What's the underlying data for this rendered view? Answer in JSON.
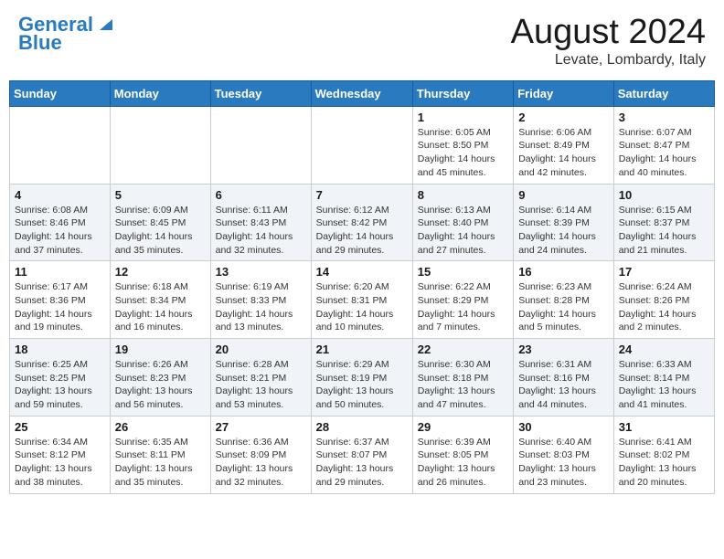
{
  "header": {
    "logo_line1": "General",
    "logo_line2": "Blue",
    "month": "August 2024",
    "location": "Levate, Lombardy, Italy"
  },
  "weekdays": [
    "Sunday",
    "Monday",
    "Tuesday",
    "Wednesday",
    "Thursday",
    "Friday",
    "Saturday"
  ],
  "weeks": [
    [
      {
        "day": "",
        "info": ""
      },
      {
        "day": "",
        "info": ""
      },
      {
        "day": "",
        "info": ""
      },
      {
        "day": "",
        "info": ""
      },
      {
        "day": "1",
        "info": "Sunrise: 6:05 AM\nSunset: 8:50 PM\nDaylight: 14 hours and 45 minutes."
      },
      {
        "day": "2",
        "info": "Sunrise: 6:06 AM\nSunset: 8:49 PM\nDaylight: 14 hours and 42 minutes."
      },
      {
        "day": "3",
        "info": "Sunrise: 6:07 AM\nSunset: 8:47 PM\nDaylight: 14 hours and 40 minutes."
      }
    ],
    [
      {
        "day": "4",
        "info": "Sunrise: 6:08 AM\nSunset: 8:46 PM\nDaylight: 14 hours and 37 minutes."
      },
      {
        "day": "5",
        "info": "Sunrise: 6:09 AM\nSunset: 8:45 PM\nDaylight: 14 hours and 35 minutes."
      },
      {
        "day": "6",
        "info": "Sunrise: 6:11 AM\nSunset: 8:43 PM\nDaylight: 14 hours and 32 minutes."
      },
      {
        "day": "7",
        "info": "Sunrise: 6:12 AM\nSunset: 8:42 PM\nDaylight: 14 hours and 29 minutes."
      },
      {
        "day": "8",
        "info": "Sunrise: 6:13 AM\nSunset: 8:40 PM\nDaylight: 14 hours and 27 minutes."
      },
      {
        "day": "9",
        "info": "Sunrise: 6:14 AM\nSunset: 8:39 PM\nDaylight: 14 hours and 24 minutes."
      },
      {
        "day": "10",
        "info": "Sunrise: 6:15 AM\nSunset: 8:37 PM\nDaylight: 14 hours and 21 minutes."
      }
    ],
    [
      {
        "day": "11",
        "info": "Sunrise: 6:17 AM\nSunset: 8:36 PM\nDaylight: 14 hours and 19 minutes."
      },
      {
        "day": "12",
        "info": "Sunrise: 6:18 AM\nSunset: 8:34 PM\nDaylight: 14 hours and 16 minutes."
      },
      {
        "day": "13",
        "info": "Sunrise: 6:19 AM\nSunset: 8:33 PM\nDaylight: 14 hours and 13 minutes."
      },
      {
        "day": "14",
        "info": "Sunrise: 6:20 AM\nSunset: 8:31 PM\nDaylight: 14 hours and 10 minutes."
      },
      {
        "day": "15",
        "info": "Sunrise: 6:22 AM\nSunset: 8:29 PM\nDaylight: 14 hours and 7 minutes."
      },
      {
        "day": "16",
        "info": "Sunrise: 6:23 AM\nSunset: 8:28 PM\nDaylight: 14 hours and 5 minutes."
      },
      {
        "day": "17",
        "info": "Sunrise: 6:24 AM\nSunset: 8:26 PM\nDaylight: 14 hours and 2 minutes."
      }
    ],
    [
      {
        "day": "18",
        "info": "Sunrise: 6:25 AM\nSunset: 8:25 PM\nDaylight: 13 hours and 59 minutes."
      },
      {
        "day": "19",
        "info": "Sunrise: 6:26 AM\nSunset: 8:23 PM\nDaylight: 13 hours and 56 minutes."
      },
      {
        "day": "20",
        "info": "Sunrise: 6:28 AM\nSunset: 8:21 PM\nDaylight: 13 hours and 53 minutes."
      },
      {
        "day": "21",
        "info": "Sunrise: 6:29 AM\nSunset: 8:19 PM\nDaylight: 13 hours and 50 minutes."
      },
      {
        "day": "22",
        "info": "Sunrise: 6:30 AM\nSunset: 8:18 PM\nDaylight: 13 hours and 47 minutes."
      },
      {
        "day": "23",
        "info": "Sunrise: 6:31 AM\nSunset: 8:16 PM\nDaylight: 13 hours and 44 minutes."
      },
      {
        "day": "24",
        "info": "Sunrise: 6:33 AM\nSunset: 8:14 PM\nDaylight: 13 hours and 41 minutes."
      }
    ],
    [
      {
        "day": "25",
        "info": "Sunrise: 6:34 AM\nSunset: 8:12 PM\nDaylight: 13 hours and 38 minutes."
      },
      {
        "day": "26",
        "info": "Sunrise: 6:35 AM\nSunset: 8:11 PM\nDaylight: 13 hours and 35 minutes."
      },
      {
        "day": "27",
        "info": "Sunrise: 6:36 AM\nSunset: 8:09 PM\nDaylight: 13 hours and 32 minutes."
      },
      {
        "day": "28",
        "info": "Sunrise: 6:37 AM\nSunset: 8:07 PM\nDaylight: 13 hours and 29 minutes."
      },
      {
        "day": "29",
        "info": "Sunrise: 6:39 AM\nSunset: 8:05 PM\nDaylight: 13 hours and 26 minutes."
      },
      {
        "day": "30",
        "info": "Sunrise: 6:40 AM\nSunset: 8:03 PM\nDaylight: 13 hours and 23 minutes."
      },
      {
        "day": "31",
        "info": "Sunrise: 6:41 AM\nSunset: 8:02 PM\nDaylight: 13 hours and 20 minutes."
      }
    ]
  ]
}
